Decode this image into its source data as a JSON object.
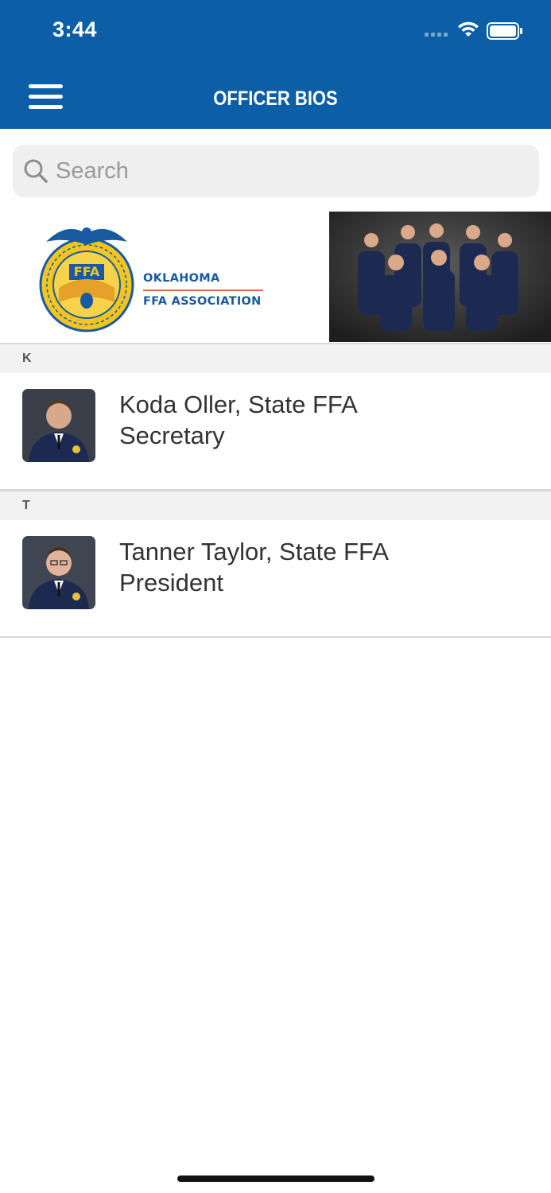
{
  "status_bar": {
    "time": "3:44"
  },
  "header": {
    "title": "OFFICER BIOS"
  },
  "search": {
    "placeholder": "Search",
    "value": ""
  },
  "banner": {
    "emblem_text": "FFA",
    "org_line1": "OKLAHOMA",
    "org_line2": "FFA ASSOCIATION"
  },
  "sections": [
    {
      "letter": "K",
      "items": [
        {
          "name": "Koda Oller, State FFA Secretary"
        }
      ]
    },
    {
      "letter": "T",
      "items": [
        {
          "name": "Tanner Taylor, State FFA President"
        }
      ]
    }
  ],
  "colors": {
    "header_bg": "#0c5ea6",
    "section_bg": "#f2f2f2",
    "brand_gold": "#f2c523",
    "brand_blue": "#1a5aa0"
  },
  "icons": [
    "menu-icon",
    "search-icon",
    "wifi-icon",
    "battery-icon",
    "signal-icon"
  ]
}
